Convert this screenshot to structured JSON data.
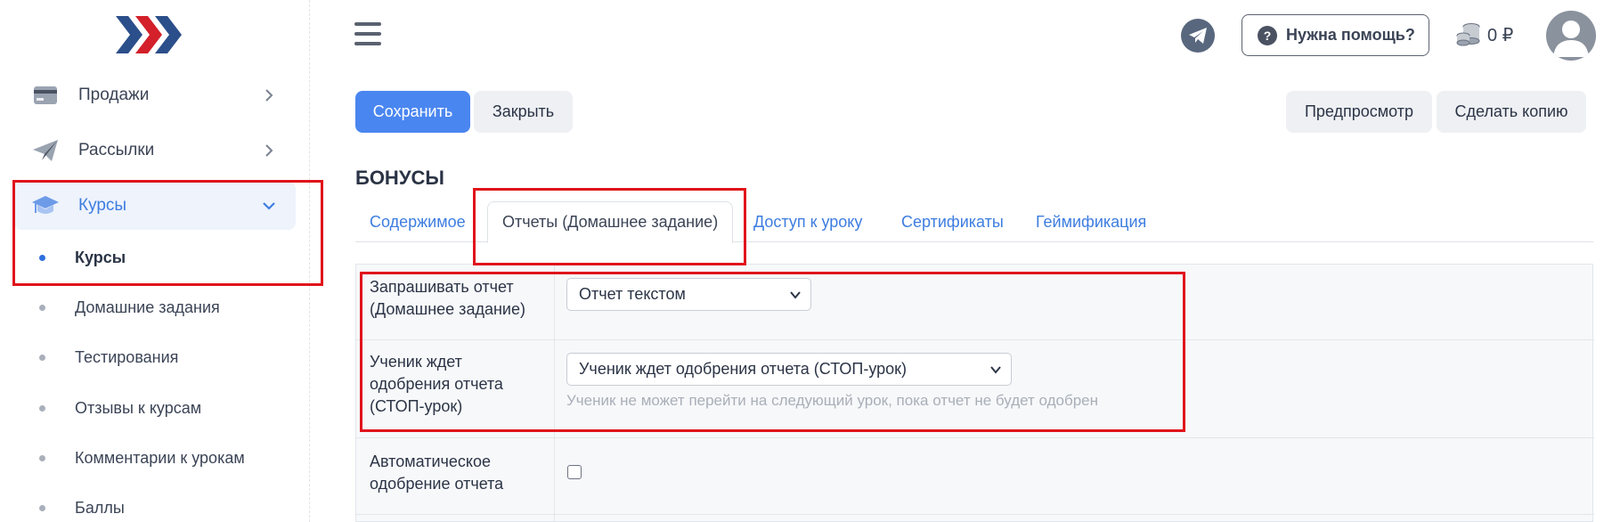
{
  "sidebar": {
    "items": [
      {
        "label": "Продажи",
        "icon": "credit-card-icon"
      },
      {
        "label": "Рассылки",
        "icon": "paper-plane-icon"
      },
      {
        "label": "Курсы",
        "icon": "graduation-cap-icon"
      }
    ],
    "subitems": [
      {
        "label": "Курсы"
      },
      {
        "label": "Домашние задания"
      },
      {
        "label": "Тестирования"
      },
      {
        "label": "Отзывы к курсам"
      },
      {
        "label": "Комментарии к урокам"
      },
      {
        "label": "Баллы"
      }
    ]
  },
  "header": {
    "help_label": "Нужна помощь?",
    "help_icon": "?",
    "balance": "0 ₽"
  },
  "toolbar": {
    "save_label": "Сохранить",
    "close_label": "Закрыть",
    "preview_label": "Предпросмотр",
    "copy_label": "Сделать копию"
  },
  "section_title": "БОНУСЫ",
  "tabs": [
    {
      "label": "Содержимое"
    },
    {
      "label": "Отчеты (Домашнее задание)"
    },
    {
      "label": "Доступ к уроку"
    },
    {
      "label": "Сертификаты"
    },
    {
      "label": "Геймификация"
    }
  ],
  "form": {
    "report_request": {
      "label_line1": "Запрашивать отчет",
      "label_line2": "(Домашнее задание)",
      "value": "Отчет текстом"
    },
    "approval": {
      "label_line1": "Ученик ждет",
      "label_line2": "одобрения отчета",
      "label_line3": "(СТОП-урок)",
      "value": "Ученик ждет одобрения отчета (СТОП-урок)",
      "hint": "Ученик не может перейти на следующий урок, пока отчет не будет одобрен"
    },
    "auto_approval": {
      "label_line1": "Автоматическое",
      "label_line2": "одобрение отчета",
      "checked": false
    }
  },
  "colors": {
    "accent": "#4a86f0",
    "highlight": "#e0141b",
    "link": "#3d7de0"
  }
}
